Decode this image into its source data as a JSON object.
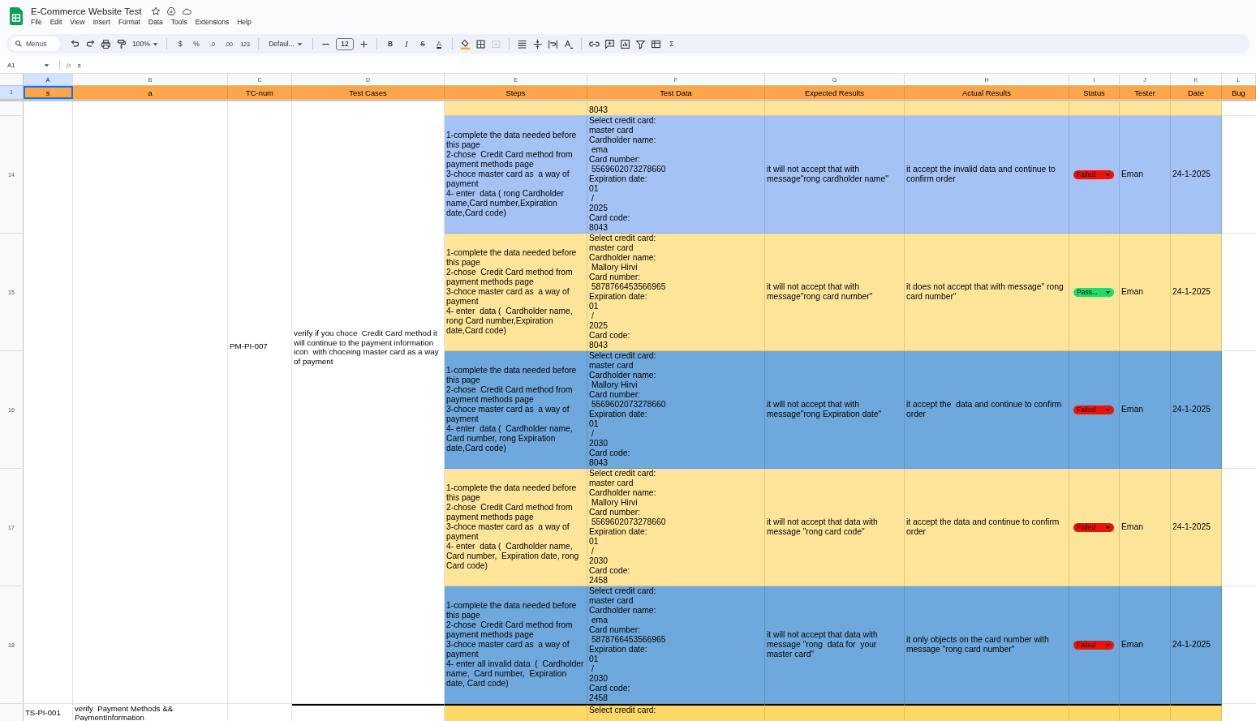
{
  "document": {
    "title": "E-Commerce Website Test"
  },
  "menu": [
    "File",
    "Edit",
    "View",
    "Insert",
    "Format",
    "Data",
    "Tools",
    "Extensions",
    "Help"
  ],
  "toolbar": {
    "search_placeholder": "Menus",
    "zoom": "100%",
    "currency": "$",
    "percent": "%",
    "decimal_less": ".0",
    "decimal_more": ".00",
    "number_format": "123",
    "font": "Defaul...",
    "font_size": "12",
    "bold": "B",
    "italic": "I",
    "strikethrough": "S",
    "text_color": "A",
    "sum": "Σ"
  },
  "formula_bar": {
    "cell_ref": "A1",
    "fx": "fx",
    "content": "s"
  },
  "columns": [
    {
      "letter": "A",
      "selected": true
    },
    {
      "letter": "B",
      "selected": false
    },
    {
      "letter": "C",
      "selected": false
    },
    {
      "letter": "D",
      "selected": false
    },
    {
      "letter": "E",
      "selected": false
    },
    {
      "letter": "F",
      "selected": false
    },
    {
      "letter": "G",
      "selected": false
    },
    {
      "letter": "H",
      "selected": false
    },
    {
      "letter": "I",
      "selected": false
    },
    {
      "letter": "J",
      "selected": false
    },
    {
      "letter": "K",
      "selected": false
    },
    {
      "letter": "L",
      "selected": false
    }
  ],
  "header_row": {
    "number": "1",
    "cells": [
      "s",
      "a",
      "TC-num",
      "Test Cases",
      "Steps",
      "Test Data",
      "Expected Results",
      "Actual Results",
      "Status",
      "Tester",
      "Date",
      "Bug"
    ]
  },
  "group": {
    "tc_num": "PM-PI-007",
    "test_case": "verify if you choce  Credit Card method it will continue to the payment information icon  with choceing master card as a way of payment"
  },
  "partial_row": {
    "color": "#ffe599",
    "test_data": "8043"
  },
  "rows": [
    {
      "number": "14",
      "color": "#a4c2f4",
      "steps": "1-complete the data needed before this page\n2-chose  Credit Card method from payment methods page\n3-choce master card as  a way of payment\n4- enter  data ( rong Cardholder name,Card number,Expiration date,Card code)",
      "test_data": "Select credit card:\nmaster card\nCardholder name:\n ema\nCard number:\n 5569602073278660\nExpiration date:\n01\n /\n2025\nCard code:\n8043",
      "expected": "it will not accept that with message\"rong cardholder name\"",
      "actual": "it accept the invalid data and continue to confirm order",
      "status": {
        "label": "Failed",
        "color": "#e8140c"
      },
      "tester": "Eman",
      "date": "24-1-2025"
    },
    {
      "number": "15",
      "color": "#ffe599",
      "steps": "1-complete the data needed before this page\n2-chose  Credit Card method from payment methods page\n3-choce master card as  a way of payment\n4- enter  data (  Cardholder name, rong Card number,Expiration date,Card code)",
      "test_data": "Select credit card:\nmaster card\nCardholder name:\n Mallory Hirvi\nCard number:\n 5878766453566965\nExpiration date:\n01\n /\n2025\nCard code:\n8043",
      "expected": "it will not accept that with message\"rong card number\"",
      "actual": "it does not accept that with message\" rong card number\"",
      "status": {
        "label": "Pass...",
        "color": "#22d96b"
      },
      "tester": "Eman",
      "date": "24-1-2025"
    },
    {
      "number": "16",
      "color": "#6fa8dc",
      "steps": "1-complete the data needed before this page\n2-chose  Credit Card method from payment methods page\n3-choce master card as  a way of payment\n4- enter  data (  Cardholder name, Card number, rong Expiration date,Card code)",
      "test_data": "Select credit card:\nmaster card\nCardholder name:\n Mallory Hirvi\nCard number:\n 5569602073278660\nExpiration date:\n01\n /\n2030\nCard code:\n8043",
      "expected": "it will not accept that with message\"rong Expiration date\"",
      "actual": "it accept the  data and continue to confirm order",
      "status": {
        "label": "Failed",
        "color": "#e8140c"
      },
      "tester": "Eman",
      "date": "24-1-2025"
    },
    {
      "number": "17",
      "color": "#ffe599",
      "steps": "1-complete the data needed before this page\n2-chose  Credit Card method from payment methods page\n3-choce master card as  a way of payment\n4- enter  data (  Cardholder name, Card number,  Expiration date, rong Card code)",
      "test_data": "Select credit card:\nmaster card\nCardholder name:\n Mallory Hirvi\nCard number:\n 5569602073278660\nExpiration date:\n01\n /\n2030\nCard code:\n2458",
      "expected": "it will not accept that data with message \"rong card code\"",
      "actual": "it accept the data and continue to confirm order",
      "status": {
        "label": "Failed",
        "color": "#e8140c"
      },
      "tester": "Eman",
      "date": "24-1-2025"
    },
    {
      "number": "18",
      "color": "#6fa8dc",
      "steps": "1-complete the data needed before this page\n2-chose  Credit Card method from payment methods page\n3-choce master card as  a way of payment\n4- enter all invalid data  (  Cardholder name,  Card number,  Expiration date, Card code)",
      "test_data": "Select credit card:\nmaster card\nCardholder name:\n ema\nCard number:\n 5878766453566965\nExpiration date:\n01\n /\n2030\nCard code:\n2458",
      "expected": "it will not accept that data with message \"rong  data for  your master card\"",
      "actual": "it only objects on the card number with message \"rong card number\"",
      "status": {
        "label": "Failed",
        "color": "#e8140c"
      },
      "tester": "Eman",
      "date": "24-1-2025"
    }
  ],
  "next_row": {
    "color": "#ffd966",
    "suite_id": "TS-PI-001",
    "suite_name": "verify  Payment Methods && PaymentInformation",
    "test_data": "Select credit card:"
  }
}
